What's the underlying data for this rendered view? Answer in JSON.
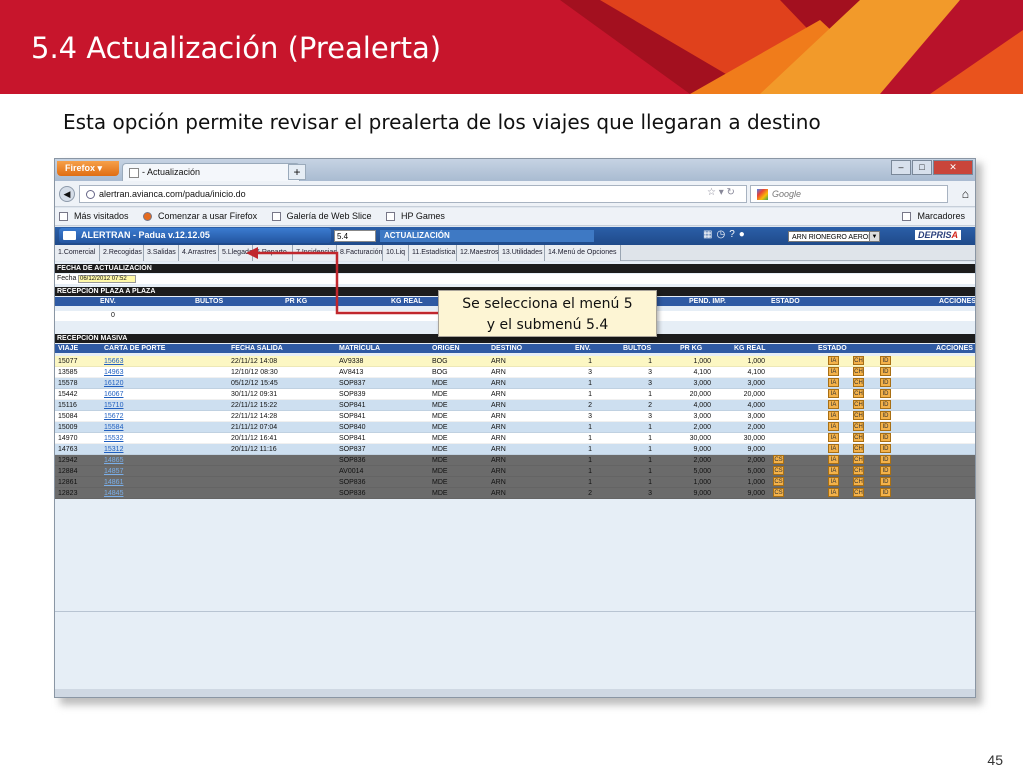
{
  "slide": {
    "title": "5.4 Actualización (Prealerta)",
    "subtitle": "Esta opción permite revisar el prealerta de los viajes que llegaran a destino",
    "page_number": "45",
    "colors": {
      "banner": "#c7152c",
      "accent_orange": "#f07c1b"
    }
  },
  "browser": {
    "firefox_button": "Firefox",
    "tab_title": "- Actualización",
    "new_tab": "+",
    "url": "alertran.avianca.com/padua/inicio.do",
    "search_placeholder": "Google",
    "bookmarks": [
      "Más visitados",
      "Comenzar a usar Firefox",
      "Galería de Web Slice",
      "HP Games"
    ],
    "bookmarks_menu": "Marcadores"
  },
  "app": {
    "name": "ALERTRAN - Padua  v.12.12.05",
    "menu_code": "5.4",
    "menu_label": "ACTUALIZACIÓN",
    "branch": "ARN RIONEGRO AEROP",
    "brand": {
      "first": "DEPRIS",
      "last": "A"
    },
    "modules": [
      "1.Comercial",
      "2.Recogidas",
      "3.Salidas",
      "4.Arrastres",
      "5.Llegadas",
      "6.Reparto",
      "7.Incidencias",
      "8.Facturación",
      "10.Liq",
      "11.Estadística",
      "12.Maestros",
      "13.Utilidades",
      "14.Menú de Opciones"
    ]
  },
  "fecha_section": {
    "header": "FECHA DE ACTUALIZACIÓN",
    "label": "Fecha",
    "value": "06/12/2012 07:52"
  },
  "plaza_section": {
    "header": "RECEPCIÓN PLAZA A PLAZA",
    "columns": [
      "ENV.",
      "BULTOS",
      "PR KG",
      "KG REAL",
      "PEND. IMP.",
      "ESTADO",
      "ACCIONES"
    ],
    "value": "0"
  },
  "masiva_section": {
    "header": "RECEPCIÓN MASIVA",
    "columns": [
      "VIAJE",
      "CARTA DE PORTE",
      "FECHA SALIDA",
      "MATRÍCULA",
      "ORIGEN",
      "DESTINO",
      "ENV.",
      "BULTOS",
      "PR KG",
      "KG REAL",
      "ESTADO",
      "ACCIONES"
    ],
    "rows": [
      {
        "viaje": "15077",
        "carta": "15663",
        "fecha": "22/11/12 14:08",
        "matricula": "AV9338",
        "origen": "BOG",
        "destino": "ARN",
        "env": "1",
        "bultos": "1",
        "prkg": "1,000",
        "kgreal": "1,000",
        "cs": "",
        "style": "hl"
      },
      {
        "viaje": "13585",
        "carta": "14963",
        "fecha": "12/10/12 08:30",
        "matricula": "AV8413",
        "origen": "BOG",
        "destino": "ARN",
        "env": "3",
        "bultos": "3",
        "prkg": "4,100",
        "kgreal": "4,100",
        "cs": "",
        "style": "white"
      },
      {
        "viaje": "15578",
        "carta": "16120",
        "fecha": "05/12/12 15:45",
        "matricula": "SOP837",
        "origen": "MDE",
        "destino": "ARN",
        "env": "1",
        "bultos": "3",
        "prkg": "3,000",
        "kgreal": "3,000",
        "cs": "",
        "style": "blue"
      },
      {
        "viaje": "15442",
        "carta": "16067",
        "fecha": "30/11/12 09:31",
        "matricula": "SOP839",
        "origen": "MDE",
        "destino": "ARN",
        "env": "1",
        "bultos": "1",
        "prkg": "20,000",
        "kgreal": "20,000",
        "cs": "",
        "style": "white"
      },
      {
        "viaje": "15116",
        "carta": "15710",
        "fecha": "22/11/12 15:22",
        "matricula": "SOP841",
        "origen": "MDE",
        "destino": "ARN",
        "env": "2",
        "bultos": "2",
        "prkg": "4,000",
        "kgreal": "4,000",
        "cs": "",
        "style": "blue"
      },
      {
        "viaje": "15084",
        "carta": "15672",
        "fecha": "22/11/12 14:28",
        "matricula": "SOP841",
        "origen": "MDE",
        "destino": "ARN",
        "env": "3",
        "bultos": "3",
        "prkg": "3,000",
        "kgreal": "3,000",
        "cs": "",
        "style": "white"
      },
      {
        "viaje": "15009",
        "carta": "15584",
        "fecha": "21/11/12 07:04",
        "matricula": "SOP840",
        "origen": "MDE",
        "destino": "ARN",
        "env": "1",
        "bultos": "1",
        "prkg": "2,000",
        "kgreal": "2,000",
        "cs": "",
        "style": "blue"
      },
      {
        "viaje": "14970",
        "carta": "15532",
        "fecha": "20/11/12 16:41",
        "matricula": "SOP841",
        "origen": "MDE",
        "destino": "ARN",
        "env": "1",
        "bultos": "1",
        "prkg": "30,000",
        "kgreal": "30,000",
        "cs": "",
        "style": "white"
      },
      {
        "viaje": "14763",
        "carta": "15312",
        "fecha": "20/11/12 11:16",
        "matricula": "SOP837",
        "origen": "MDE",
        "destino": "ARN",
        "env": "1",
        "bultos": "1",
        "prkg": "9,000",
        "kgreal": "9,000",
        "cs": "",
        "style": "blue"
      },
      {
        "viaje": "12942",
        "carta": "14865",
        "fecha": "",
        "matricula": "SOP836",
        "origen": "MDE",
        "destino": "ARN",
        "env": "1",
        "bultos": "1",
        "prkg": "2,000",
        "kgreal": "2,000",
        "cs": "CS",
        "style": "gray"
      },
      {
        "viaje": "12884",
        "carta": "14857",
        "fecha": "",
        "matricula": "AV0014",
        "origen": "MDE",
        "destino": "ARN",
        "env": "1",
        "bultos": "1",
        "prkg": "5,000",
        "kgreal": "5,000",
        "cs": "CS",
        "style": "gray"
      },
      {
        "viaje": "12861",
        "carta": "14861",
        "fecha": "",
        "matricula": "SOP836",
        "origen": "MDE",
        "destino": "ARN",
        "env": "1",
        "bultos": "1",
        "prkg": "1,000",
        "kgreal": "1,000",
        "cs": "CS",
        "style": "gray"
      },
      {
        "viaje": "12823",
        "carta": "14845",
        "fecha": "",
        "matricula": "SOP836",
        "origen": "MDE",
        "destino": "ARN",
        "env": "2",
        "bultos": "3",
        "prkg": "9,000",
        "kgreal": "9,000",
        "cs": "CS",
        "style": "gray"
      }
    ],
    "status_tags": [
      "IA",
      "CH",
      "ID"
    ]
  },
  "callout": {
    "line1": "Se selecciona el menú 5",
    "line2": "y el submenú 5.4",
    "arrow_color": "#c0272d"
  }
}
